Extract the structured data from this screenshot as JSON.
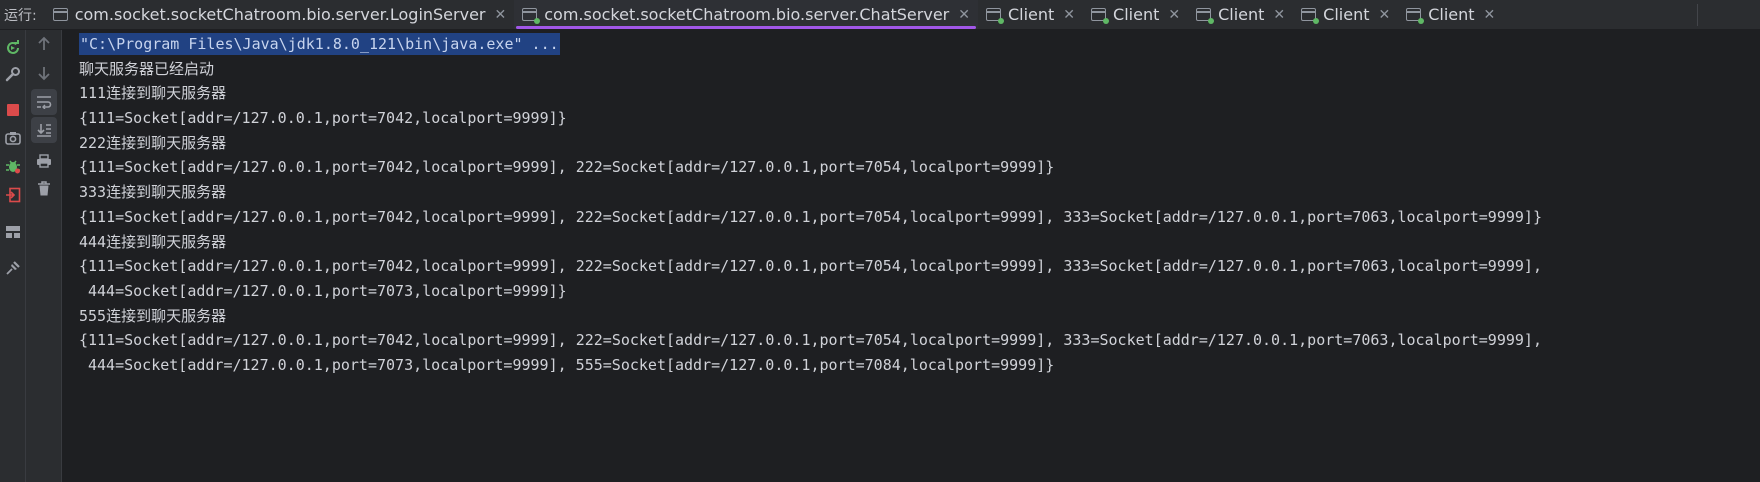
{
  "run_label": "运行:",
  "tabs": [
    {
      "title": "com.socket.socketChatroom.bio.server.LoginServer",
      "active": false
    },
    {
      "title": "com.socket.socketChatroom.bio.server.ChatServer",
      "active": true
    },
    {
      "title": "Client",
      "active": false
    },
    {
      "title": "Client",
      "active": false
    },
    {
      "title": "Client",
      "active": false
    },
    {
      "title": "Client",
      "active": false
    },
    {
      "title": "Client",
      "active": false
    }
  ],
  "close_glyph": "✕",
  "icons": {
    "rerun": "rerun-icon",
    "settings": "wrench-icon",
    "stop": "stop-icon",
    "screenshot": "camera-icon",
    "debug": "bug-icon",
    "exit": "exit-icon",
    "layout": "layout-icon",
    "pin": "pin-icon",
    "up": "arrow-up-icon",
    "down": "arrow-down-icon",
    "soft_wrap": "soft-wrap-icon",
    "scroll_end": "scroll-to-end-icon",
    "print": "print-icon",
    "clear": "trash-icon"
  },
  "colors": {
    "accent": "#a157e8",
    "stop": "#db4b4b",
    "run": "#5fb865",
    "selection": "#214283"
  },
  "console": {
    "command": "\"C:\\Program Files\\Java\\jdk1.8.0_121\\bin\\java.exe\" ...",
    "lines": [
      "聊天服务器已经启动",
      "111连接到聊天服务器",
      "{111=Socket[addr=/127.0.0.1,port=7042,localport=9999]}",
      "222连接到聊天服务器",
      "{111=Socket[addr=/127.0.0.1,port=7042,localport=9999], 222=Socket[addr=/127.0.0.1,port=7054,localport=9999]}",
      "333连接到聊天服务器",
      "{111=Socket[addr=/127.0.0.1,port=7042,localport=9999], 222=Socket[addr=/127.0.0.1,port=7054,localport=9999], 333=Socket[addr=/127.0.0.1,port=7063,localport=9999]}",
      "444连接到聊天服务器",
      "{111=Socket[addr=/127.0.0.1,port=7042,localport=9999], 222=Socket[addr=/127.0.0.1,port=7054,localport=9999], 333=Socket[addr=/127.0.0.1,port=7063,localport=9999],",
      "444=Socket[addr=/127.0.0.1,port=7073,localport=9999]}",
      "555连接到聊天服务器",
      "{111=Socket[addr=/127.0.0.1,port=7042,localport=9999], 222=Socket[addr=/127.0.0.1,port=7054,localport=9999], 333=Socket[addr=/127.0.0.1,port=7063,localport=9999],",
      "444=Socket[addr=/127.0.0.1,port=7073,localport=9999], 555=Socket[addr=/127.0.0.1,port=7084,localport=9999]}"
    ]
  }
}
